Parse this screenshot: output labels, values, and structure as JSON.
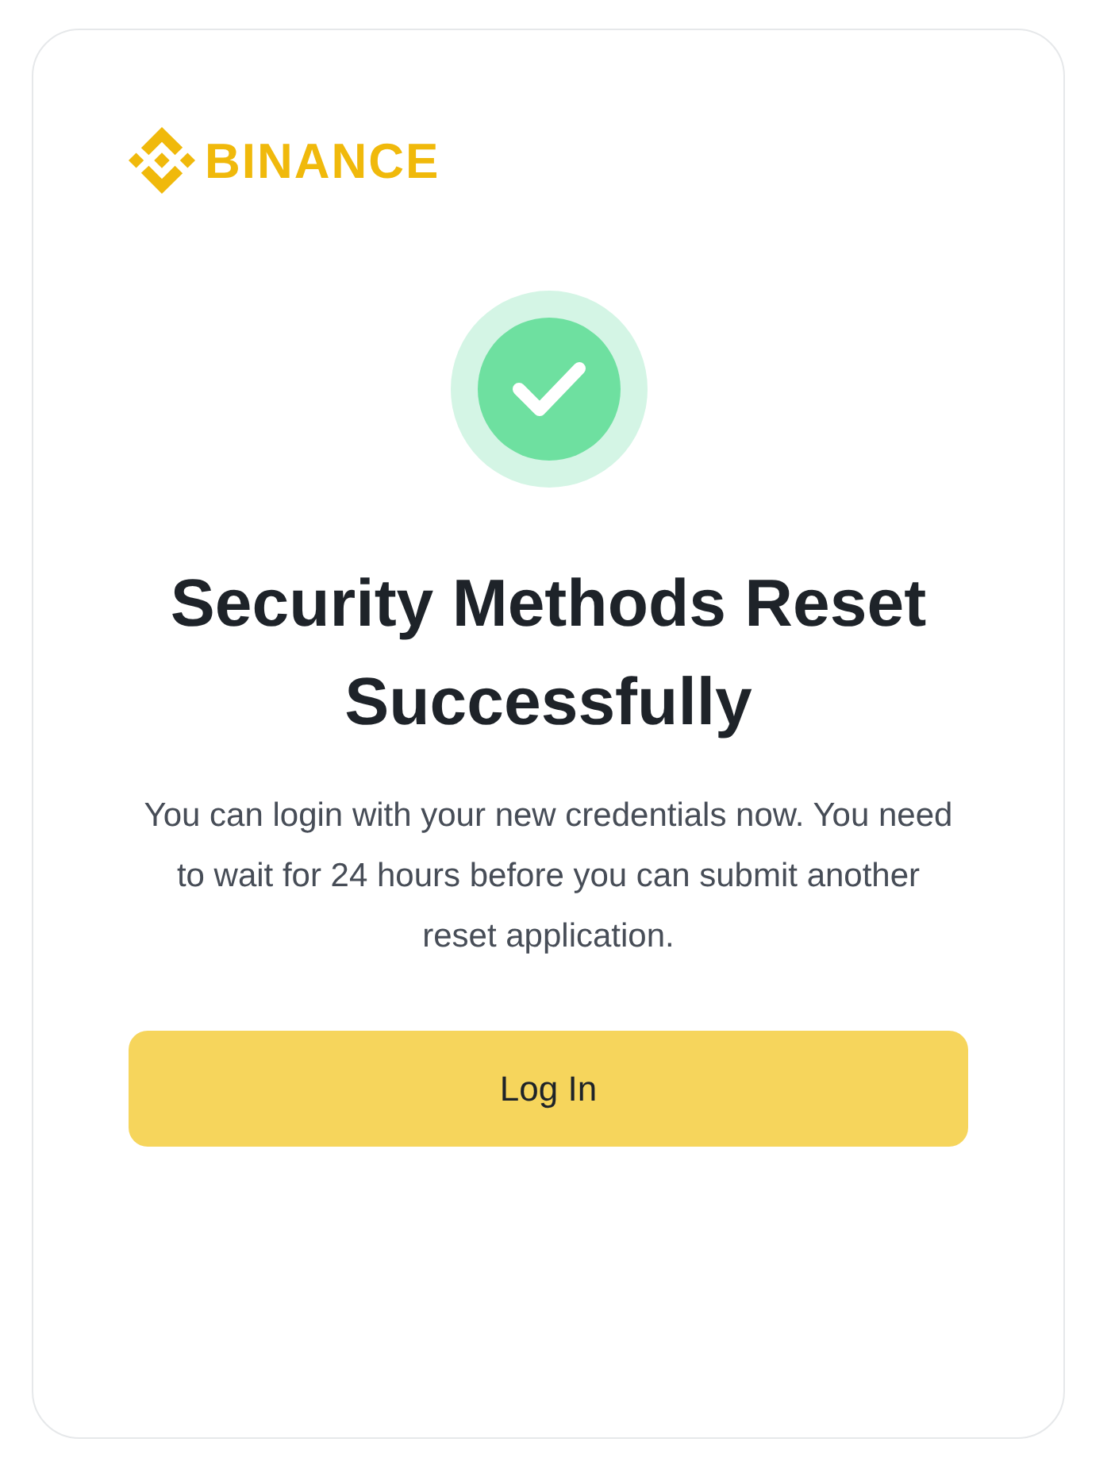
{
  "brand": {
    "name": "BINANCE"
  },
  "status": {
    "kind": "success"
  },
  "title": "Security Methods Reset Successfully",
  "message": "You can login with your new credentials now. You need to wait for 24 hours before you can submit another reset application.",
  "buttons": [
    {
      "label": "Log In"
    }
  ]
}
